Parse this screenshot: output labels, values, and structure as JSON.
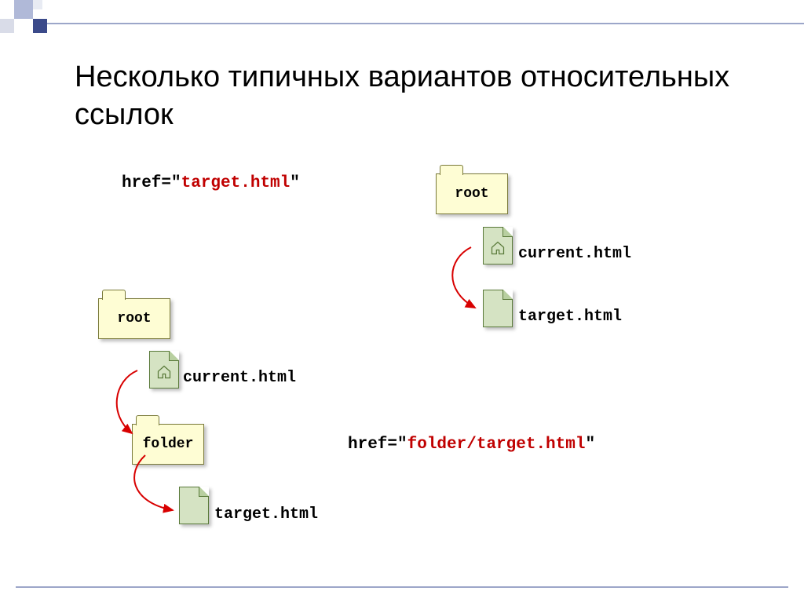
{
  "title": "Несколько типичных вариантов относительных ссылок",
  "example1": {
    "href_prefix": "href=\"",
    "href_value": "target.html",
    "href_suffix": "\"",
    "root_label": "root",
    "current_file": "current.html",
    "target_file": "target.html"
  },
  "example2": {
    "href_prefix": "href=\"",
    "href_value": "folder/target.html",
    "href_suffix": "\"",
    "root_label": "root",
    "folder_label": "folder",
    "current_file": "current.html",
    "target_file": "target.html"
  }
}
